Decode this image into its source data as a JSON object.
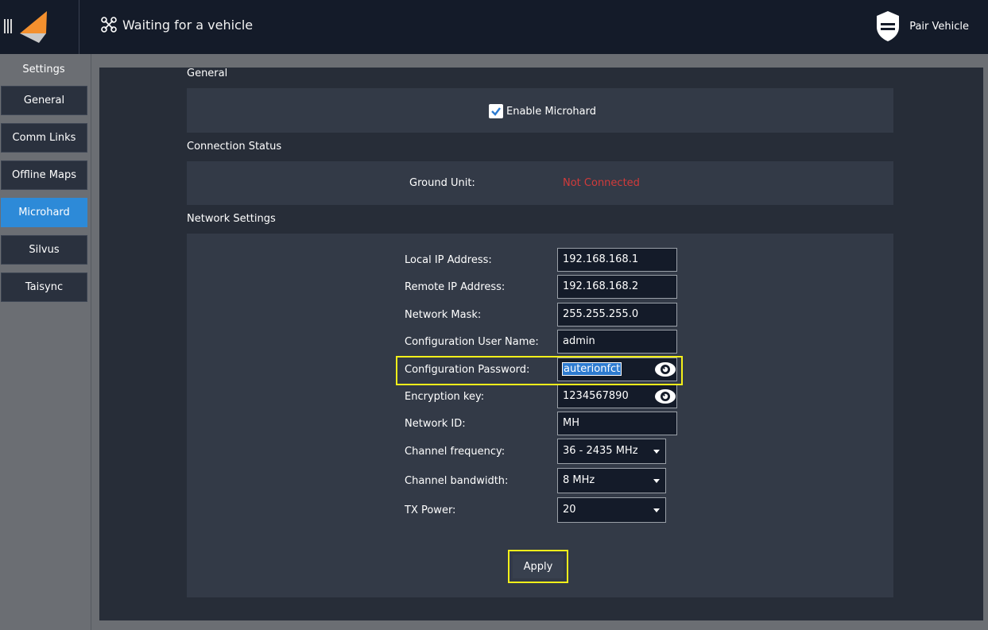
{
  "topbar": {
    "vehicle_status": "Waiting for a vehicle",
    "pair_label": "Pair Vehicle"
  },
  "sidebar": {
    "title": "Settings",
    "items": [
      {
        "label": "General"
      },
      {
        "label": "Comm Links"
      },
      {
        "label": "Offline Maps"
      },
      {
        "label": "Microhard",
        "active": true
      },
      {
        "label": "Silvus"
      },
      {
        "label": "Taisync"
      }
    ]
  },
  "general": {
    "header": "General",
    "enable_label": "Enable Microhard",
    "enabled": true
  },
  "connection": {
    "header": "Connection Status",
    "ground_unit_label": "Ground Unit:",
    "ground_unit_value": "Not Connected"
  },
  "network": {
    "header": "Network Settings",
    "fields": [
      {
        "label": "Local IP Address:",
        "value": "192.168.168.1"
      },
      {
        "label": "Remote IP Address:",
        "value": "192.168.168.2"
      },
      {
        "label": "Network Mask:",
        "value": "255.255.255.0"
      },
      {
        "label": "Configuration User Name:",
        "value": "admin"
      },
      {
        "label": "Configuration Password:",
        "value": "auterionfct"
      },
      {
        "label": "Encryption key:",
        "value": "1234567890"
      },
      {
        "label": "Network ID:",
        "value": "MH"
      }
    ],
    "combos": [
      {
        "label": "Channel frequency:",
        "value": "36 - 2435 MHz"
      },
      {
        "label": "Channel bandwidth:",
        "value": "8 MHz"
      },
      {
        "label": "TX Power:",
        "value": "20"
      }
    ],
    "apply_label": "Apply"
  },
  "colors": {
    "topbar": "#141b29",
    "accent": "#2d8ad8",
    "error": "#d23b3b",
    "highlight": "#f5f01a",
    "logo": "#f4902e"
  }
}
